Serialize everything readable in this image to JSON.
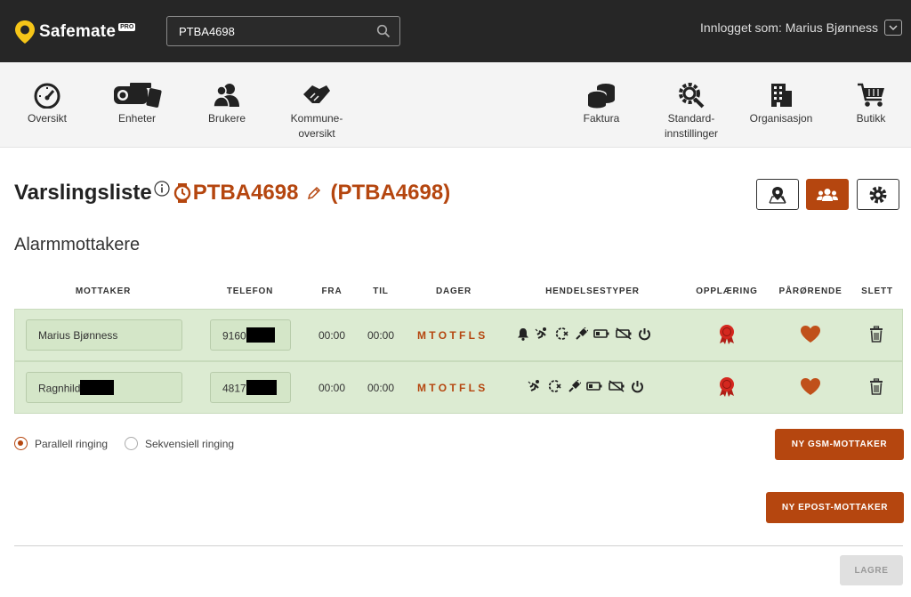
{
  "app": {
    "name": "Safemate",
    "badge": "PRO"
  },
  "search": {
    "value": "PTBA4698"
  },
  "user": {
    "logged_in_text": "Innlogget som: Marius Bjønness"
  },
  "nav": {
    "left": [
      {
        "label": "Oversikt",
        "icon": "speedometer-icon"
      },
      {
        "label": "Enheter",
        "icon": "devices-icon"
      },
      {
        "label": "Brukere",
        "icon": "users-icon"
      },
      {
        "label_line1": "Kommune-",
        "label_line2": "oversikt",
        "icon": "handshake-icon"
      }
    ],
    "right": [
      {
        "label": "Faktura",
        "icon": "coins-icon"
      },
      {
        "label_line1": "Standard-",
        "label_line2": "innstillinger",
        "icon": "gear-search-icon"
      },
      {
        "label": "Organisasjon",
        "icon": "building-icon"
      },
      {
        "label": "Butikk",
        "icon": "cart-icon"
      }
    ]
  },
  "header": {
    "title": "Varslingsliste",
    "device_name": "PTBA4698",
    "device_alias": "(PTBA4698)"
  },
  "section_title": "Alarmmottakere",
  "table": {
    "columns": [
      "MOTTAKER",
      "TELEFON",
      "FRA",
      "TIL",
      "DAGER",
      "HENDELSESTYPER",
      "OPPLÆRING",
      "PÅRØRENDE",
      "SLETT"
    ],
    "rows": [
      {
        "name": "Marius Bjønness",
        "phone": "9160",
        "from": "00:00",
        "to": "00:00",
        "days": "MTOTFLS"
      },
      {
        "name": "Ragnhild",
        "phone": "4817",
        "from": "00:00",
        "to": "00:00",
        "days": "MTOTFLS"
      }
    ]
  },
  "ringing": {
    "parallel": "Parallell ringing",
    "sequential": "Sekvensiell ringing",
    "selected": "parallel"
  },
  "buttons": {
    "new_gsm": "NY GSM-MOTTAKER",
    "new_email": "NY EPOST-MOTTAKER",
    "save": "LAGRE"
  },
  "colors": {
    "accent": "#b5460f",
    "topbar": "#262626",
    "logo_yellow": "#f5c518",
    "row_bg": "#dcebd2",
    "heart": "#c0501a",
    "badge_red": "#d4281f"
  }
}
